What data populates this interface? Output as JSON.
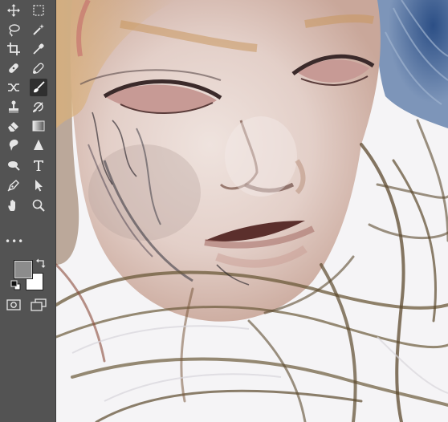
{
  "toolbar": {
    "tools": [
      {
        "id": "move",
        "icon": "move-icon"
      },
      {
        "id": "rect-marquee",
        "icon": "rectangular-marquee-icon"
      },
      {
        "id": "lasso",
        "icon": "lasso-icon"
      },
      {
        "id": "magic-wand",
        "icon": "magic-wand-icon"
      },
      {
        "id": "crop",
        "icon": "crop-icon"
      },
      {
        "id": "eyedropper",
        "icon": "eyedropper-icon"
      },
      {
        "id": "healing",
        "icon": "healing-brush-icon"
      },
      {
        "id": "spot-healing",
        "icon": "spot-healing-icon"
      },
      {
        "id": "content-aware-move",
        "icon": "content-aware-move-icon"
      },
      {
        "id": "brush",
        "icon": "brush-icon",
        "active": true
      },
      {
        "id": "clone-stamp",
        "icon": "clone-stamp-icon"
      },
      {
        "id": "history-brush",
        "icon": "history-brush-icon"
      },
      {
        "id": "eraser",
        "icon": "eraser-icon"
      },
      {
        "id": "gradient",
        "icon": "gradient-icon"
      },
      {
        "id": "smudge",
        "icon": "smudge-icon"
      },
      {
        "id": "sharpen",
        "icon": "sharpen-icon"
      },
      {
        "id": "dodge",
        "icon": "dodge-icon"
      },
      {
        "id": "type",
        "icon": "type-icon"
      },
      {
        "id": "pen",
        "icon": "pen-icon"
      },
      {
        "id": "path-selection",
        "icon": "path-selection-icon"
      },
      {
        "id": "hand",
        "icon": "hand-icon"
      },
      {
        "id": "zoom",
        "icon": "zoom-icon"
      }
    ],
    "more_label": "•••"
  },
  "colors": {
    "foreground": "#8c8c8c",
    "background": "#ffffff",
    "toolbar_bg": "#535353",
    "icon_color": "#e6e6e6"
  },
  "canvas": {
    "content": "painted-portrait-artwork"
  }
}
